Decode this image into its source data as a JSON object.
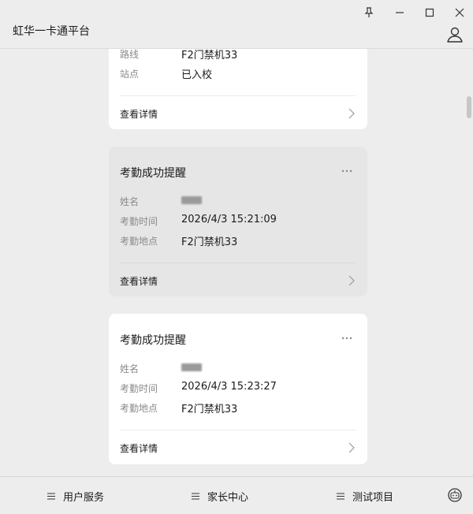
{
  "window": {
    "title": "虹华一卡通平台",
    "controls": {
      "pin": "pin",
      "minimize": "minimize",
      "maximize": "maximize",
      "close": "close"
    }
  },
  "cards": [
    {
      "title": "",
      "rows": [
        {
          "label": "路线",
          "value": "F2门禁机33"
        },
        {
          "label": "站点",
          "value": "已入校"
        }
      ],
      "detail_label": "查看详情"
    },
    {
      "title": "考勤成功提醒",
      "rows": [
        {
          "label": "姓名",
          "value": ""
        },
        {
          "label": "考勤时间",
          "value": "2026/4/3 15:21:09"
        },
        {
          "label": "考勤地点",
          "value": "F2门禁机33"
        }
      ],
      "detail_label": "查看详情",
      "more_label": "···"
    },
    {
      "title": "考勤成功提醒",
      "rows": [
        {
          "label": "姓名",
          "value": ""
        },
        {
          "label": "考勤时间",
          "value": "2026/4/3 15:23:27"
        },
        {
          "label": "考勤地点",
          "value": "F2门禁机33"
        }
      ],
      "detail_label": "查看详情",
      "more_label": "···"
    }
  ],
  "bottom_nav": [
    {
      "label": "用户服务",
      "icon": "menu-icon"
    },
    {
      "label": "家长中心",
      "icon": "menu-icon"
    },
    {
      "label": "测试项目",
      "icon": "menu-icon"
    }
  ],
  "colors": {
    "background": "#ededed",
    "card": "#ffffff",
    "card_hover": "#e6e6e6",
    "label": "#8a8a8a",
    "text": "#1a1a1a"
  }
}
